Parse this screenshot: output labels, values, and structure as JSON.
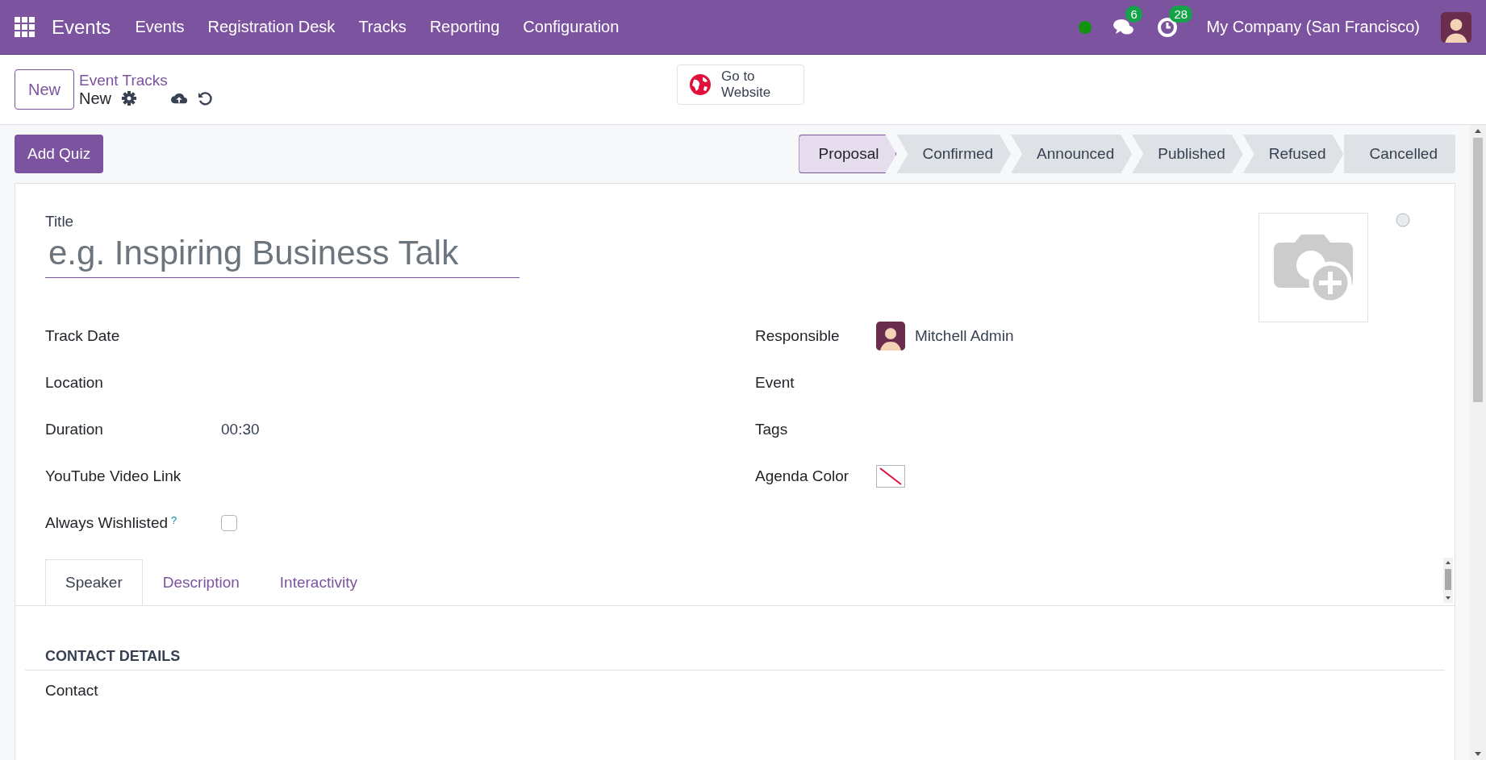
{
  "navbar": {
    "app_name": "Events",
    "menu": [
      "Events",
      "Registration Desk",
      "Tracks",
      "Reporting",
      "Configuration"
    ],
    "messages_count": "6",
    "activities_count": "28",
    "company": "My Company (San Francisco)"
  },
  "control_panel": {
    "new_button": "New",
    "breadcrumb": "Event Tracks",
    "record_name": "New",
    "website_button": "Go to Website"
  },
  "statusbar": {
    "button": "Add Quiz",
    "stages": [
      {
        "label": "Proposal",
        "selected": true
      },
      {
        "label": "Confirmed",
        "selected": false
      },
      {
        "label": "Announced",
        "selected": false
      },
      {
        "label": "Published",
        "selected": false
      },
      {
        "label": "Refused",
        "selected": false
      },
      {
        "label": "Cancelled",
        "selected": false
      }
    ]
  },
  "form": {
    "title_label": "Title",
    "title_placeholder": "e.g. Inspiring Business Talk",
    "left_fields": [
      {
        "label": "Track Date",
        "kind": "text"
      },
      {
        "label": "Location",
        "kind": "text"
      },
      {
        "label": "Duration",
        "kind": "text",
        "value": "00:30"
      },
      {
        "label": "YouTube Video Link",
        "kind": "text"
      },
      {
        "label": "Always Wishlisted",
        "kind": "checkbox",
        "help": "?",
        "checked": false
      }
    ],
    "right_fields": [
      {
        "label": "Responsible",
        "kind": "user",
        "value": "Mitchell Admin"
      },
      {
        "label": "Event",
        "kind": "text"
      },
      {
        "label": "Tags",
        "kind": "text"
      },
      {
        "label": "Agenda Color",
        "kind": "color"
      }
    ]
  },
  "tabs": [
    {
      "label": "Speaker",
      "selected": true
    },
    {
      "label": "Description",
      "selected": false
    },
    {
      "label": "Interactivity",
      "selected": false
    }
  ],
  "section_title": "CONTACT DETAILS",
  "contact_label": "Contact"
}
